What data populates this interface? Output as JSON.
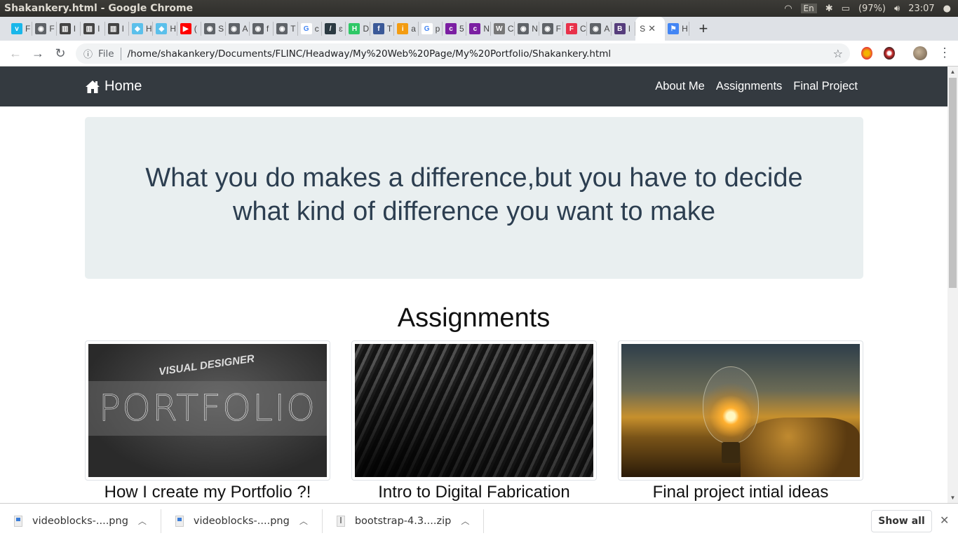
{
  "os": {
    "window_title": "Shakankery.html - Google Chrome",
    "keyboard_layout": "En",
    "battery": "(97%)",
    "time": "23:07",
    "tray_icons": [
      "wifi-icon",
      "keyboard-icon",
      "bluetooth-icon",
      "battery-icon",
      "volume-icon",
      "apple-icon"
    ]
  },
  "browser": {
    "tabs": [
      {
        "icon": "vimeo-icon",
        "letter": "F",
        "color": "#1ab7ea",
        "glyph": "v"
      },
      {
        "icon": "globe-icon",
        "letter": "F",
        "color": "#5f6368",
        "glyph": "◉"
      },
      {
        "icon": "book-icon",
        "letter": "I",
        "color": "#444",
        "glyph": "▥"
      },
      {
        "icon": "book-icon",
        "letter": "I",
        "color": "#444",
        "glyph": "▥"
      },
      {
        "icon": "book-icon",
        "letter": "I",
        "color": "#444",
        "glyph": "▥"
      },
      {
        "icon": "bird-icon",
        "letter": "H",
        "color": "#5bc0eb",
        "glyph": "◆"
      },
      {
        "icon": "bird-icon",
        "letter": "H",
        "color": "#5bc0eb",
        "glyph": "◆"
      },
      {
        "icon": "youtube-icon",
        "letter": "(",
        "color": "#ff0000",
        "glyph": "▶"
      },
      {
        "icon": "globe-icon",
        "letter": "S",
        "color": "#5f6368",
        "glyph": "◉"
      },
      {
        "icon": "globe-icon",
        "letter": "A",
        "color": "#5f6368",
        "glyph": "◉"
      },
      {
        "icon": "globe-icon",
        "letter": "f",
        "color": "#5f6368",
        "glyph": "◉"
      },
      {
        "icon": "globe-icon",
        "letter": "T",
        "color": "#5f6368",
        "glyph": "◉"
      },
      {
        "icon": "google-icon",
        "letter": "c",
        "color": "#fff",
        "glyph": "G"
      },
      {
        "icon": "pen-icon",
        "letter": "ɛ",
        "color": "#2b3a42",
        "glyph": "/"
      },
      {
        "icon": "hackerrank-icon",
        "letter": "D",
        "color": "#2ec866",
        "glyph": "H"
      },
      {
        "icon": "facebook-icon",
        "letter": "T",
        "color": "#3b5998",
        "glyph": "f"
      },
      {
        "icon": "idea-icon",
        "letter": "a",
        "color": "#f39c12",
        "glyph": "i"
      },
      {
        "icon": "google-icon",
        "letter": "p",
        "color": "#fff",
        "glyph": "G"
      },
      {
        "icon": "colorlib-icon",
        "letter": "5",
        "color": "#7b1fa2",
        "glyph": "c"
      },
      {
        "icon": "colorlib-icon",
        "letter": "N",
        "color": "#7b1fa2",
        "glyph": "c"
      },
      {
        "icon": "wordpress-icon",
        "letter": "C",
        "color": "#777",
        "glyph": "W"
      },
      {
        "icon": "globe-icon",
        "letter": "N",
        "color": "#5f6368",
        "glyph": "◉"
      },
      {
        "icon": "globe-icon",
        "letter": "F",
        "color": "#5f6368",
        "glyph": "◉"
      },
      {
        "icon": "fiverr-icon",
        "letter": "C",
        "color": "#e8314a",
        "glyph": "F"
      },
      {
        "icon": "globe-icon",
        "letter": "A",
        "color": "#5f6368",
        "glyph": "◉"
      },
      {
        "icon": "bootstrap-icon",
        "letter": "I",
        "color": "#563d7c",
        "glyph": "B"
      }
    ],
    "active_tab": {
      "letter": "S",
      "close": "✕"
    },
    "after_tabs": [
      {
        "icon": "flag-icon",
        "letter": "H",
        "color": "#4285f4",
        "glyph": "⚑"
      }
    ],
    "new_tab": "+",
    "address": {
      "security_label": "File",
      "url": "/home/shakankery/Documents/FLINC/Headway/My%20Web%20Page/My%20Portfolio/Shakankery.html"
    }
  },
  "page": {
    "navbar": {
      "brand": "Home",
      "links": [
        "About Me",
        "Assignments",
        "Final Project"
      ]
    },
    "jumbotron": {
      "quote": "What you do makes a difference,but you have to decide what kind of difference you want to make"
    },
    "section_title": "Assignments",
    "cards": [
      {
        "title": "How I create my Portfolio ?!",
        "image_text": "PORTFOLIO",
        "image_subtext": "VISUAL DESIGNER"
      },
      {
        "title": "Intro to Digital Fabrication"
      },
      {
        "title": "Final project intial ideas"
      }
    ]
  },
  "downloads": {
    "items": [
      {
        "name": "videoblocks-....png",
        "type": "png"
      },
      {
        "name": "videoblocks-....png",
        "type": "png"
      },
      {
        "name": "bootstrap-4.3....zip",
        "type": "zip"
      }
    ],
    "show_all": "Show all",
    "close": "✕"
  }
}
